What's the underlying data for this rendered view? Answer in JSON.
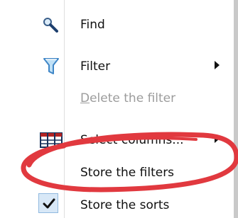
{
  "menu": {
    "items": [
      {
        "label": "Find",
        "icon": "magnifier-icon",
        "has_submenu": false
      },
      {
        "label": "Filter",
        "icon": "funnel-icon",
        "has_submenu": true
      },
      {
        "label": "Delete the filter",
        "icon": "",
        "has_submenu": false,
        "disabled": true
      },
      {
        "label": "Select columns...",
        "icon": "columns-icon",
        "has_submenu": true
      },
      {
        "label": "Store the filters",
        "icon": "",
        "has_submenu": false
      },
      {
        "label": "Store the sorts",
        "icon": "checkmark-icon",
        "checked": true,
        "has_submenu": false
      }
    ]
  },
  "colors": {
    "annotation": "#e1393f",
    "disabled_text": "#9c9c9c",
    "checked_bg": "#d8e8f7"
  }
}
